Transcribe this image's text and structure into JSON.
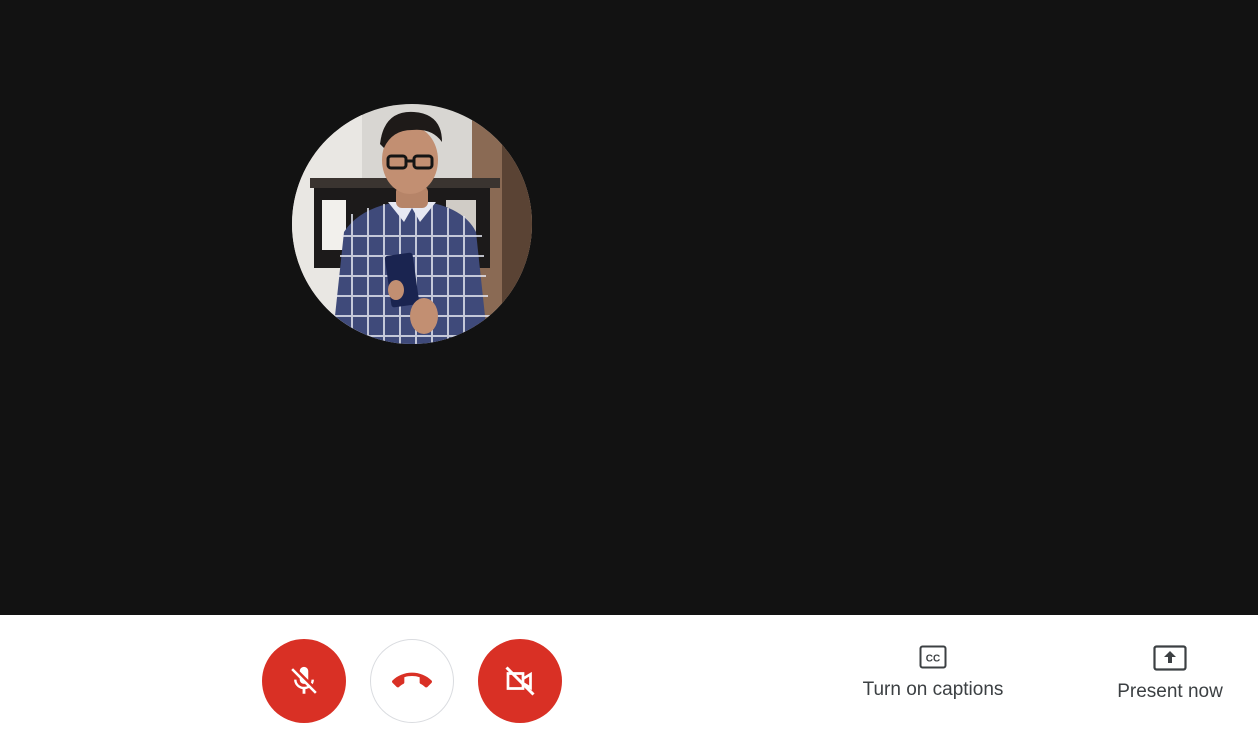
{
  "stage": {
    "background": "#121212",
    "participant": {
      "avatar": "participant-photo"
    }
  },
  "controls": {
    "mic": {
      "icon": "mic-off-icon",
      "state": "muted",
      "color": "#d93025"
    },
    "hangup": {
      "icon": "call-end-icon",
      "color": "#d93025"
    },
    "camera": {
      "icon": "videocam-off-icon",
      "state": "off",
      "color": "#d93025"
    },
    "captions": {
      "icon": "closed-caption-icon",
      "label": "Turn on captions"
    },
    "present": {
      "icon": "present-to-all-icon",
      "label": "Present now"
    }
  }
}
